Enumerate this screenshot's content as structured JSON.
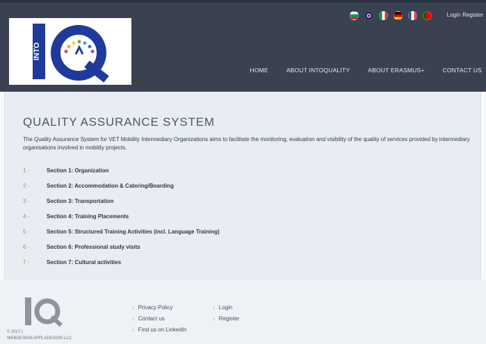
{
  "header": {
    "flags": [
      {
        "name": "bulgarian-flag-icon",
        "colors": [
          "#ffffff",
          "#00966e",
          "#d62612"
        ]
      },
      {
        "name": "uk-flag-icon",
        "colors": [
          "#012169",
          "#ffffff",
          "#c8102e"
        ]
      },
      {
        "name": "italian-flag-icon",
        "colors": [
          "#009246",
          "#ffffff",
          "#ce2b37"
        ]
      },
      {
        "name": "german-flag-icon",
        "colors": [
          "#000000",
          "#dd0000",
          "#ffce00"
        ]
      },
      {
        "name": "french-flag-icon",
        "colors": [
          "#0055a4",
          "#ffffff",
          "#ef4135"
        ]
      },
      {
        "name": "portuguese-flag-icon",
        "colors": [
          "#006600",
          "#ff0000",
          "#ff0000"
        ]
      }
    ],
    "login_label": "Login",
    "register_label": "Register",
    "nav": {
      "home": "HOME",
      "about_intoquality": "ABOUT INTOQUALITY",
      "about_erasmus": "ABOUT ERASMUS+",
      "contact_us": "CONTACT US"
    }
  },
  "main": {
    "title": "QUALITY ASSURANCE SYSTEM",
    "intro": "The Quality Assurance System for VET Mobility Intermediary Organizations aims to facilitate the monitoring, evaluation and visibility of the quality of services provided by intermediary organisations involved in mobility projects.",
    "sections": [
      {
        "num": "1 -",
        "label": "Section 1: Organization"
      },
      {
        "num": "2 -",
        "label": "Section 2: Accommodation & Catering/Boarding"
      },
      {
        "num": "3 -",
        "label": "Section 3: Transportation"
      },
      {
        "num": "4 -",
        "label": "Section 4: Training Placements"
      },
      {
        "num": "5 -",
        "label": "Section 5: Structured Training Activities (incl. Language Training)"
      },
      {
        "num": "6 -",
        "label": "Section 6: Professional study visits"
      },
      {
        "num": "7 -",
        "label": "Section 7: Cultural activities"
      }
    ]
  },
  "footer": {
    "copyright_line1": "© 2017 |",
    "copyright_line2": "WEBDESIGN APPLADESIGN LLC",
    "col1": [
      "Privacy Policy",
      "Contact us",
      "Find us on LinkedIn"
    ],
    "col2": [
      "Login",
      "Register"
    ]
  },
  "colors": {
    "header_bg": "#3a4150",
    "logo_blue": "#1e3a9a",
    "accent_orange": "#d9733e",
    "main_bg": "#e8edf4"
  }
}
